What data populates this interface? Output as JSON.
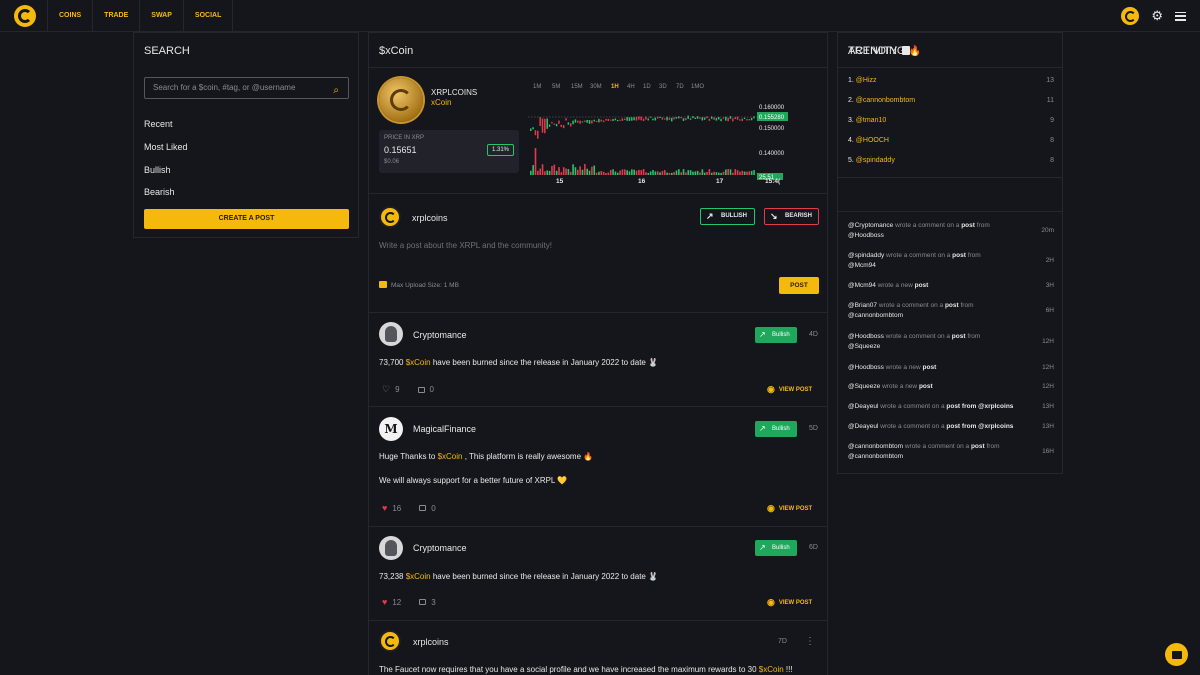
{
  "colors": {
    "accent": "#f5b90d",
    "bullish": "#27c46b",
    "bearish": "#e6394b",
    "background": "#15161b"
  },
  "nav": {
    "items": [
      "COINS",
      "TRADE",
      "SWAP",
      "SOCIAL"
    ]
  },
  "search": {
    "title": "SEARCH",
    "placeholder": "Search for a $coin, #tag, or @username",
    "menu": [
      "Recent",
      "Most Liked",
      "Bullish",
      "Bearish"
    ],
    "create_label": "CREATE A POST"
  },
  "coin": {
    "title": "$xCoin",
    "name": "XRPLCOINS",
    "ticker": "xCoin",
    "price_label": "PRICE IN XRP",
    "price": "0.15651",
    "price_usd": "$0.06",
    "change": "1.31%",
    "timeframes": [
      "1M",
      "5M",
      "15M",
      "30M",
      "1H",
      "4H",
      "1D",
      "3D",
      "7D",
      "1MO"
    ],
    "active_timeframe": "1H"
  },
  "chart_data": {
    "type": "candlestick",
    "x_tick_labels": [
      "15",
      "16",
      "17",
      "15:4("
    ],
    "y_tick_labels": [
      "0.160000",
      "0.150000",
      "0.140000"
    ],
    "last_price_label": "0.155280",
    "volume_label": "25.51",
    "colors": {
      "up": "#27c46b",
      "down": "#e6394b"
    }
  },
  "composer": {
    "username": "xrplcoins",
    "bullish_label": "BULLISH",
    "bearish_label": "BEARISH",
    "placeholder": "Write a post about the XRPL and the community!",
    "upload_note": "Max Upload Size: 1 MB",
    "post_label": "POST"
  },
  "posts": [
    {
      "author": "Cryptomance",
      "badge": "Bullish",
      "age": "4D",
      "text_before": "73,700 ",
      "coin": "$xCoin",
      "text_after": " have been burned since the release in January 2022 to date 🐰",
      "line2": "",
      "likes": "9",
      "comments": "0",
      "view": "VIEW POST"
    },
    {
      "author": "MagicalFinance",
      "badge": "Bullish",
      "age": "5D",
      "text_before": "Huge Thanks to ",
      "coin": "$xCoin",
      "text_after": " , This platform is really awesome 🔥",
      "line2": "We will always support for a better future of XRPL 💛",
      "likes": "16",
      "comments": "0",
      "view": "VIEW POST"
    },
    {
      "author": "Cryptomance",
      "badge": "Bullish",
      "age": "6D",
      "text_before": "73,238 ",
      "coin": "$xCoin",
      "text_after": " have been burned since the release in January 2022 to date 🐰",
      "line2": "",
      "likes": "12",
      "comments": "3",
      "view": "VIEW POST"
    },
    {
      "author": "xrplcoins",
      "badge": "",
      "age": "7D",
      "text_before": "The Faucet now requires that you have a social profile and we have increased the maximum rewards to 30 ",
      "coin": "$xCoin",
      "text_after": " !!!",
      "line2": "",
      "likes": "",
      "comments": "",
      "view": ""
    }
  ],
  "trending": {
    "title": "TRENDING",
    "items": [
      {
        "rank": "1.",
        "user": "@Hizz",
        "count": "13"
      },
      {
        "rank": "2.",
        "user": "@cannonbombtom",
        "count": "11"
      },
      {
        "rank": "3.",
        "user": "@tman10",
        "count": "9"
      },
      {
        "rank": "4.",
        "user": "@HOOCH",
        "count": "8"
      },
      {
        "rank": "5.",
        "user": "@spindaddy",
        "count": "8"
      }
    ]
  },
  "activity": {
    "title": "ACTIVITY",
    "items": [
      {
        "actor": "@Cryptomance",
        "verb": " wrote a comment on a ",
        "obj": "post",
        "tail": " from",
        "target": "@Hoodboss",
        "age": "20m"
      },
      {
        "actor": "@spindaddy",
        "verb": " wrote a comment on a ",
        "obj": "post",
        "tail": " from",
        "target": "@Mcm94",
        "age": "2H"
      },
      {
        "actor": "@Mcm94",
        "verb": " wrote a new ",
        "obj": "post",
        "tail": "",
        "target": "",
        "age": "3H"
      },
      {
        "actor": "@Brian07",
        "verb": " wrote a comment on a ",
        "obj": "post",
        "tail": " from",
        "target": "@cannonbombtom",
        "age": "6H"
      },
      {
        "actor": "@Hoodboss",
        "verb": " wrote a comment on a ",
        "obj": "post",
        "tail": " from",
        "target": "@Squeeze",
        "age": "12H"
      },
      {
        "actor": "@Hoodboss",
        "verb": " wrote a new ",
        "obj": "post",
        "tail": "",
        "target": "",
        "age": "12H"
      },
      {
        "actor": "@Squeeze",
        "verb": " wrote a new ",
        "obj": "post",
        "tail": "",
        "target": "",
        "age": "12H"
      },
      {
        "actor": "@Deayeul",
        "verb": " wrote a comment on a ",
        "obj": "post",
        "tail": " from @xrplcoins",
        "target": "",
        "age": "13H"
      },
      {
        "actor": "@Deayeul",
        "verb": " wrote a comment on a ",
        "obj": "post",
        "tail": " from @xrplcoins",
        "target": "",
        "age": "13H"
      },
      {
        "actor": "@cannonbombtom",
        "verb": " wrote a comment on a ",
        "obj": "post",
        "tail": " from",
        "target": "@cannonbombtom",
        "age": "16H"
      }
    ]
  }
}
